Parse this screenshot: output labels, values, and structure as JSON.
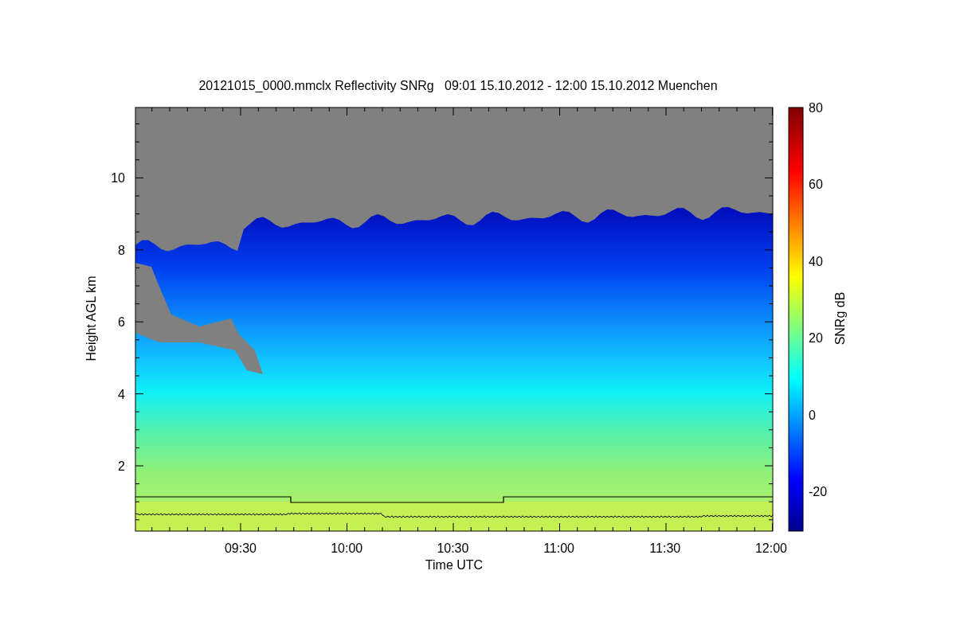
{
  "title": "20121015_0000.mmclx Reflectivity SNRg   09:01 15.10.2012 - 12:00 15.10.2012 Muenchen",
  "x_axis": {
    "label": "Time UTC",
    "ticks": [
      "09:30",
      "10:00",
      "10:30",
      "11:00",
      "11:30",
      "12:00"
    ]
  },
  "y_axis": {
    "label": "Height AGL km",
    "ticks": [
      "10",
      "8",
      "6",
      "4",
      "2"
    ]
  },
  "colorbar": {
    "label": "SNRg dB",
    "ticks": [
      "80",
      "60",
      "40",
      "20",
      "0",
      "-20"
    ]
  }
}
